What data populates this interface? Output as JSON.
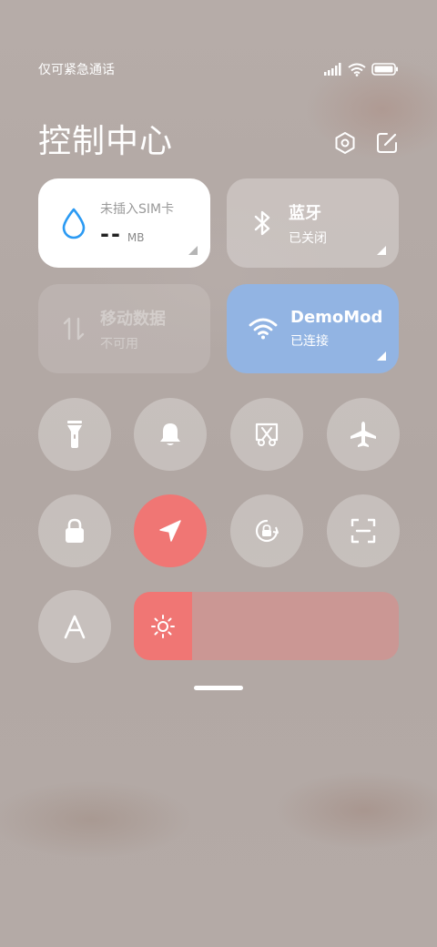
{
  "status_bar": {
    "carrier": "仅可紧急通话"
  },
  "header": {
    "title": "控制中心"
  },
  "tiles": {
    "sim": {
      "label": "未插入SIM卡",
      "value": "--",
      "unit": "MB"
    },
    "bluetooth": {
      "label": "蓝牙",
      "status": "已关闭"
    },
    "mobile_data": {
      "label": "移动数据",
      "status": "不可用"
    },
    "wifi": {
      "label": "DemoMod",
      "status": "已连接"
    }
  },
  "brightness": {
    "level": 0.22
  },
  "colors": {
    "accent_red": "#f07674",
    "wifi_blue": "#92b4e3",
    "sim_blue": "#2b9af3"
  },
  "icons": [
    "signal-icon",
    "wifi-icon",
    "battery-icon",
    "settings-hexagon-icon",
    "edit-icon",
    "water-drop-icon",
    "bluetooth-icon",
    "data-arrows-icon",
    "flashlight-icon",
    "bell-icon",
    "screenshot-icon",
    "airplane-icon",
    "lock-icon",
    "location-arrow-icon",
    "rotation-lock-icon",
    "scan-icon",
    "font-a-icon",
    "sun-icon"
  ]
}
